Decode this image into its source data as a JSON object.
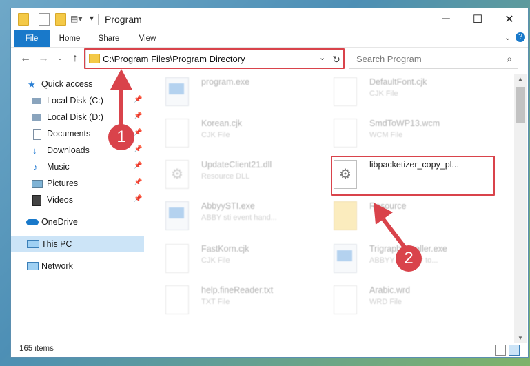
{
  "window": {
    "title": "Program"
  },
  "ribbon": {
    "file": "File",
    "home": "Home",
    "share": "Share",
    "view": "View"
  },
  "address": {
    "path": "C:\\Program Files\\Program Directory",
    "refresh_icon": "refresh-icon"
  },
  "search": {
    "placeholder": "Search Program"
  },
  "sidebar": {
    "items": [
      {
        "label": "Quick access"
      },
      {
        "label": "Local Disk (C:)"
      },
      {
        "label": "Local Disk (D:)"
      },
      {
        "label": "Documents"
      },
      {
        "label": "Downloads"
      },
      {
        "label": "Music"
      },
      {
        "label": "Pictures"
      },
      {
        "label": "Videos"
      },
      {
        "label": "OneDrive"
      },
      {
        "label": "This PC"
      },
      {
        "label": "Network"
      }
    ]
  },
  "files": [
    {
      "name": "program.exe",
      "type": ""
    },
    {
      "name": "DefaultFont.cjk",
      "type": "CJK File"
    },
    {
      "name": "Korean.cjk",
      "type": "CJK File"
    },
    {
      "name": "SmdToWP13.wcm",
      "type": "WCM File"
    },
    {
      "name": "UpdateClient21.dll",
      "type": "Resource DLL"
    },
    {
      "name": "libpacketizer_copy_pl...",
      "type": ""
    },
    {
      "name": "AbbyySTI.exe",
      "type": "ABBY sti event hand..."
    },
    {
      "name": "Resource",
      "type": ""
    },
    {
      "name": "FastKorn.cjk",
      "type": "CJK File"
    },
    {
      "name": "TrigraphInstaller.exe",
      "type": "ABBYY Installer to..."
    },
    {
      "name": "help.fineReader.txt",
      "type": "TXT File"
    },
    {
      "name": "Arabic.wrd",
      "type": "WRD File"
    }
  ],
  "status": {
    "items": "165 items"
  },
  "annotations": {
    "step1": "1",
    "step2": "2"
  },
  "colors": {
    "accent": "#1979ca",
    "highlight": "#d9434b",
    "selection": "#cce4f7"
  }
}
